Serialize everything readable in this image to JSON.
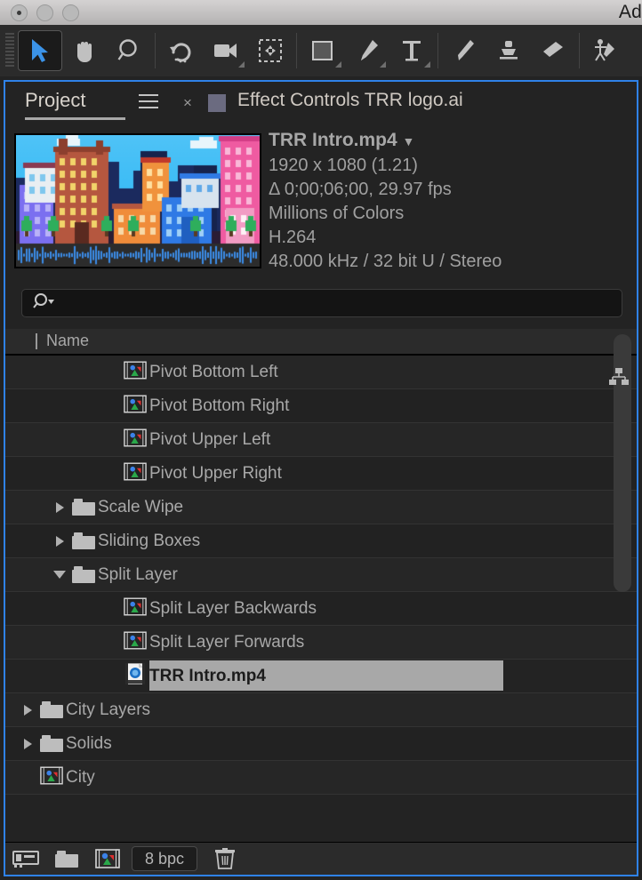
{
  "window": {
    "title": "Ad",
    "traffic_lights": [
      "close",
      "minimize",
      "zoom"
    ]
  },
  "toolbar": {
    "tools": [
      {
        "name": "selection-tool",
        "label": "Selection",
        "active": true
      },
      {
        "name": "hand-tool",
        "label": "Hand",
        "active": false
      },
      {
        "name": "zoom-tool",
        "label": "Zoom",
        "active": false
      },
      {
        "name": "rotation-tool",
        "label": "Rotation",
        "active": false
      },
      {
        "name": "camera-tool",
        "label": "Unified Camera",
        "active": false
      },
      {
        "name": "pan-behind-tool",
        "label": "Pan Behind",
        "active": false
      },
      {
        "name": "shape-tool",
        "label": "Rectangle",
        "active": false
      },
      {
        "name": "pen-tool",
        "label": "Pen",
        "active": false
      },
      {
        "name": "type-tool",
        "label": "Type",
        "active": false
      },
      {
        "name": "brush-tool",
        "label": "Brush",
        "active": false
      },
      {
        "name": "clone-stamp-tool",
        "label": "Clone Stamp",
        "active": false
      },
      {
        "name": "eraser-tool",
        "label": "Eraser",
        "active": false
      },
      {
        "name": "puppet-tool",
        "label": "Puppet Pin",
        "active": false
      }
    ]
  },
  "panel": {
    "tabs": {
      "project_label": "Project",
      "close_glyph": "×",
      "effect_controls_label": "Effect Controls TRR logo.ai"
    },
    "preview": {
      "title": "TRR Intro.mp4",
      "dropdown_glyph": "▼",
      "resolution": "1920 x 1080 (1.21)",
      "duration": "Δ 0;00;06;00, 29.97 fps",
      "color_depth": "Millions of Colors",
      "codec": "H.264",
      "audio": "48.000 kHz / 32 bit U / Stereo"
    },
    "search": {
      "value": "",
      "placeholder": ""
    },
    "columns": [
      "Name"
    ],
    "items": [
      {
        "label": "Pivot Bottom Left",
        "type": "composition",
        "indent": 3,
        "twirl": "none",
        "selected": false,
        "hierarchy_icon": true
      },
      {
        "label": "Pivot Bottom Right",
        "type": "composition",
        "indent": 3,
        "twirl": "none",
        "selected": false,
        "hierarchy_icon": false
      },
      {
        "label": "Pivot Upper Left",
        "type": "composition",
        "indent": 3,
        "twirl": "none",
        "selected": false,
        "hierarchy_icon": false
      },
      {
        "label": "Pivot Upper Right",
        "type": "composition",
        "indent": 3,
        "twirl": "none",
        "selected": false,
        "hierarchy_icon": false
      },
      {
        "label": "Scale Wipe",
        "type": "folder",
        "indent": 2,
        "twirl": "closed",
        "selected": false,
        "hierarchy_icon": false
      },
      {
        "label": "Sliding Boxes",
        "type": "folder",
        "indent": 2,
        "twirl": "closed",
        "selected": false,
        "hierarchy_icon": false
      },
      {
        "label": "Split Layer",
        "type": "folder",
        "indent": 2,
        "twirl": "open",
        "selected": false,
        "hierarchy_icon": false
      },
      {
        "label": "Split Layer Backwards",
        "type": "composition",
        "indent": 3,
        "twirl": "none",
        "selected": false,
        "hierarchy_icon": false
      },
      {
        "label": "Split Layer Forwards",
        "type": "composition",
        "indent": 3,
        "twirl": "none",
        "selected": false,
        "hierarchy_icon": false
      },
      {
        "label": "TRR Intro.mp4",
        "type": "footage",
        "indent": 3,
        "twirl": "none",
        "selected": true,
        "hierarchy_icon": false
      },
      {
        "label": "City Layers",
        "type": "folder",
        "indent": 1,
        "twirl": "closed",
        "selected": false,
        "hierarchy_icon": false
      },
      {
        "label": "Solids",
        "type": "folder",
        "indent": 1,
        "twirl": "closed",
        "selected": false,
        "hierarchy_icon": false
      },
      {
        "label": "City",
        "type": "composition",
        "indent": 1,
        "twirl": "none",
        "selected": false,
        "hierarchy_icon": false
      }
    ],
    "footer": {
      "buttons": [
        {
          "name": "interpret-footage-button",
          "label": "Interpret Footage"
        },
        {
          "name": "new-folder-button",
          "label": "New Folder"
        },
        {
          "name": "new-composition-button",
          "label": "New Composition"
        }
      ],
      "bit_depth": "8 bpc",
      "delete_label": "Delete"
    }
  },
  "colors": {
    "panel_border": "#2f82e8",
    "panel_bg": "#232323",
    "row_text": "#a9a9a9",
    "selection_bg": "#a8a8a8",
    "accent_blue": "#2f82e8"
  }
}
